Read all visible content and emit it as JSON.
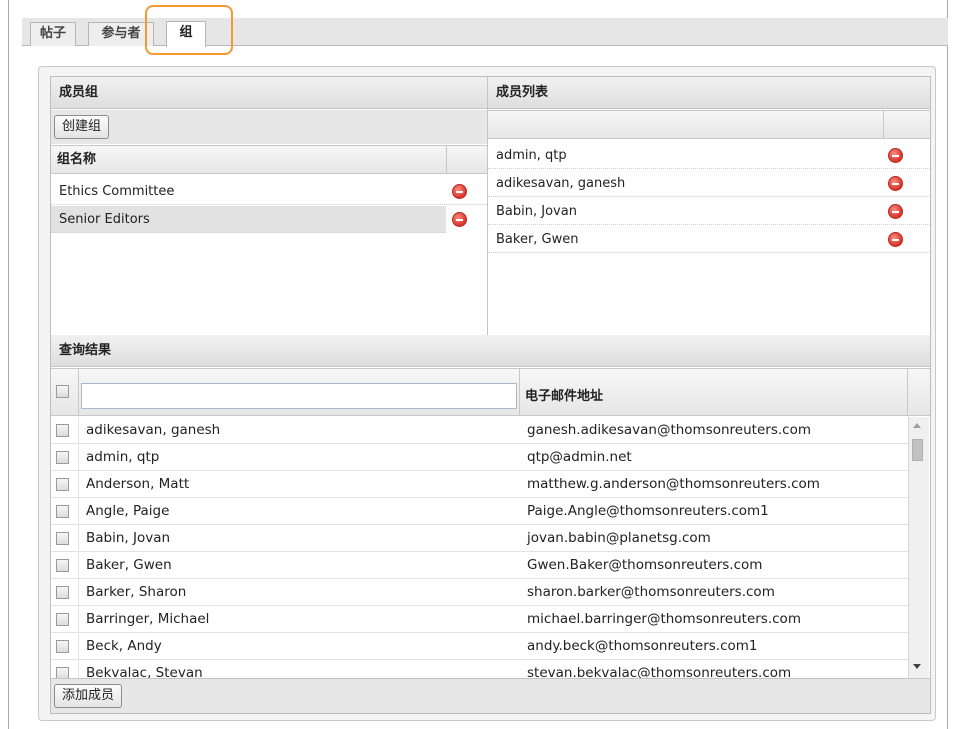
{
  "tabs": [
    {
      "label": "帖子"
    },
    {
      "label": "参与者"
    },
    {
      "label": "组"
    }
  ],
  "groups_panel": {
    "header": "成员组",
    "create_button": "创建组",
    "column_name": "组名称",
    "rows": [
      {
        "name": "Ethics Committee"
      },
      {
        "name": "Senior Editors"
      }
    ]
  },
  "members_panel": {
    "header": "成员列表",
    "rows": [
      {
        "name": "admin, qtp"
      },
      {
        "name": "adikesavan, ganesh"
      },
      {
        "name": "Babin, Jovan"
      },
      {
        "name": "Baker, Gwen"
      }
    ]
  },
  "results_panel": {
    "header": "查询结果",
    "search_value": "",
    "column_email": "电子邮件地址",
    "add_button": "添加成员",
    "rows": [
      {
        "name": "adikesavan, ganesh",
        "email": "ganesh.adikesavan@thomsonreuters.com"
      },
      {
        "name": "admin, qtp",
        "email": "qtp@admin.net"
      },
      {
        "name": "Anderson, Matt",
        "email": "matthew.g.anderson@thomsonreuters.com"
      },
      {
        "name": "Angle, Paige",
        "email": "Paige.Angle@thomsonreuters.com1"
      },
      {
        "name": "Babin, Jovan",
        "email": "jovan.babin@planetsg.com"
      },
      {
        "name": "Baker, Gwen",
        "email": "Gwen.Baker@thomsonreuters.com"
      },
      {
        "name": "Barker, Sharon",
        "email": "sharon.barker@thomsonreuters.com"
      },
      {
        "name": "Barringer, Michael",
        "email": "michael.barringer@thomsonreuters.com"
      },
      {
        "name": "Beck, Andy",
        "email": "andy.beck@thomsonreuters.com1"
      },
      {
        "name": "Bekvalac, Stevan",
        "email": "stevan.bekvalac@thomsonreuters.com"
      }
    ]
  },
  "colors": {
    "tab_highlight": "#f39a35",
    "remove_icon": "#d9342b"
  }
}
